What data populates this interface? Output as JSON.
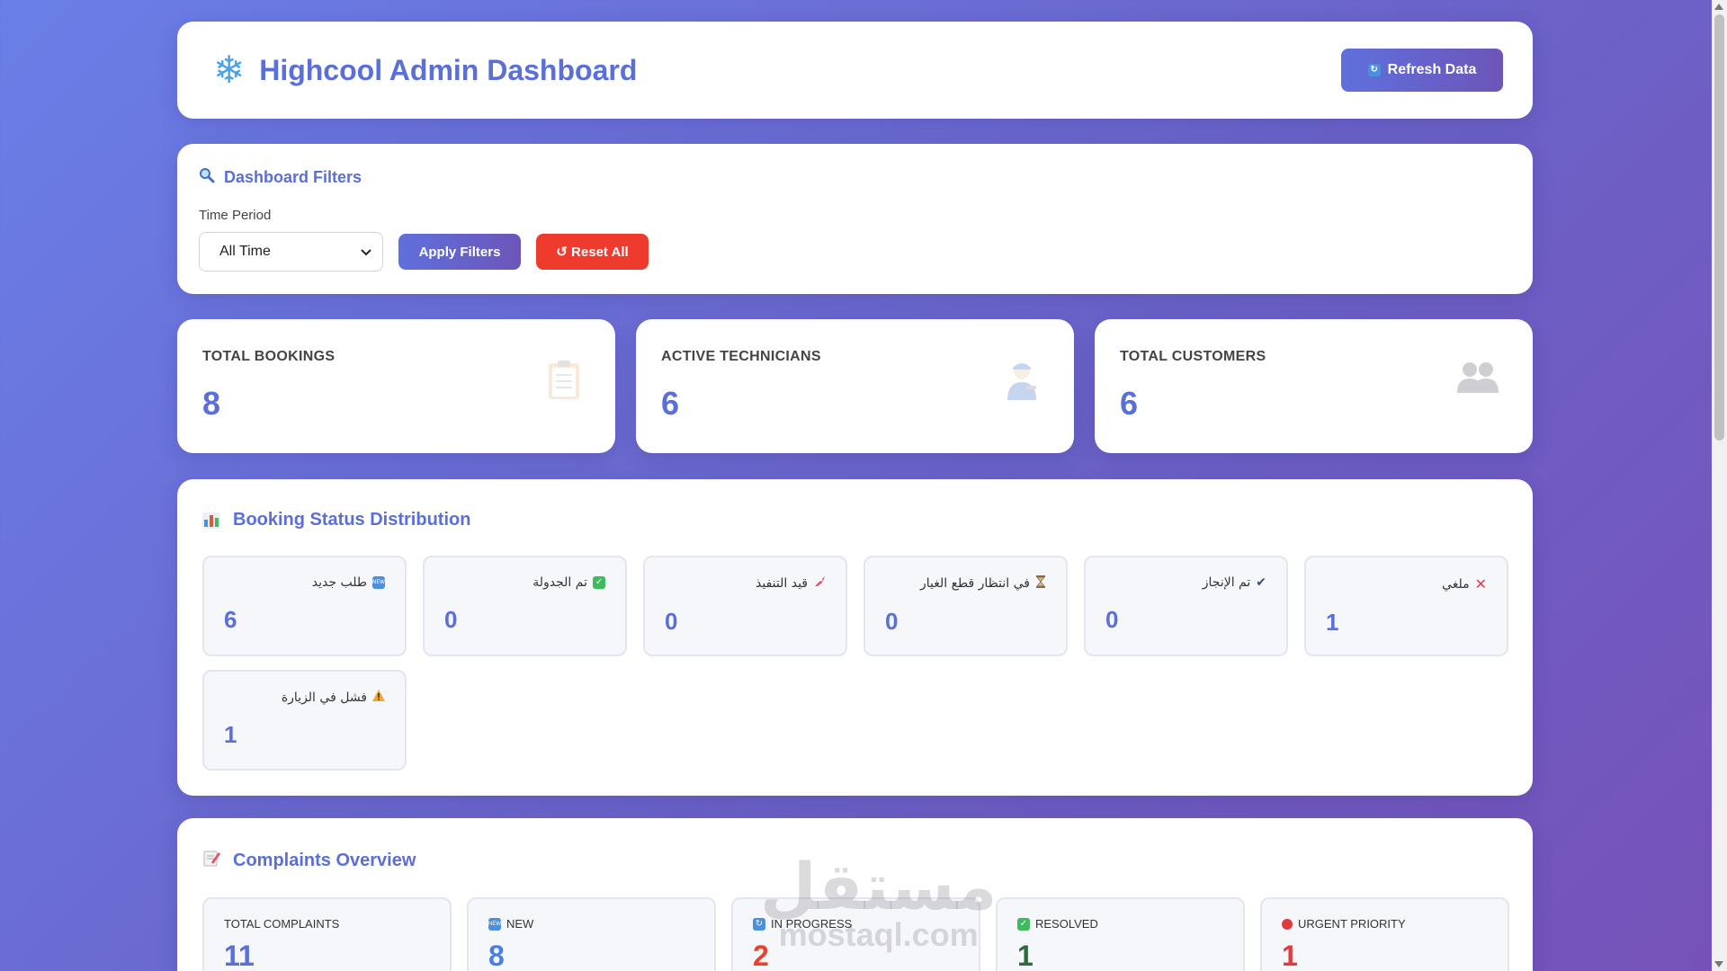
{
  "header": {
    "title": "Highcool Admin Dashboard",
    "logo_icon": "snowflake-icon",
    "refresh_label": "Refresh Data"
  },
  "filters": {
    "title": "Dashboard Filters",
    "time_period_label": "Time Period",
    "time_period_value": "All Time",
    "apply_label": "Apply Filters",
    "reset_label": "Reset All"
  },
  "stats": [
    {
      "label": "TOTAL BOOKINGS",
      "value": "8",
      "icon": "clipboard-icon"
    },
    {
      "label": "ACTIVE TECHNICIANS",
      "value": "6",
      "icon": "technician-icon"
    },
    {
      "label": "TOTAL CUSTOMERS",
      "value": "6",
      "icon": "users-icon"
    }
  ],
  "booking_status": {
    "title": "Booking Status Distribution",
    "items": [
      {
        "label": "طلب جديد",
        "value": "6",
        "icon": "new-icon"
      },
      {
        "label": "تم الجدولة",
        "value": "0",
        "icon": "check-box-icon"
      },
      {
        "label": "قيد التنفيذ",
        "value": "0",
        "icon": "rocket-icon"
      },
      {
        "label": "في انتظار قطع الغيار",
        "value": "0",
        "icon": "hourglass-icon"
      },
      {
        "label": "تم الإنجاز",
        "value": "0",
        "icon": "check-mark-icon"
      },
      {
        "label": "ملغي",
        "value": "1",
        "icon": "cross-icon"
      },
      {
        "label": "فشل في الزيارة",
        "value": "1",
        "icon": "warning-icon"
      }
    ]
  },
  "complaints": {
    "title": "Complaints Overview",
    "items": [
      {
        "label": "TOTAL COMPLAINTS",
        "value": "11",
        "color": "#5a6fd8"
      },
      {
        "label": "NEW",
        "value": "8",
        "color": "#4a7fe0",
        "icon": "new-icon"
      },
      {
        "label": "IN PROGRESS",
        "value": "2",
        "color": "#e8412e",
        "icon": "refresh-icon"
      },
      {
        "label": "RESOLVED",
        "value": "1",
        "color": "#2e6b3a",
        "icon": "check-box-icon"
      },
      {
        "label": "URGENT PRIORITY",
        "value": "1",
        "color": "#e03a3a",
        "icon": "red-dot-icon"
      }
    ]
  },
  "watermark": {
    "arabic": "مستقل",
    "latin": "mostaql.com"
  },
  "colors": {
    "accent": "#5a6fd8",
    "danger": "#ee3b2e",
    "background_start": "#6a7fe8",
    "background_end": "#7652b8"
  }
}
